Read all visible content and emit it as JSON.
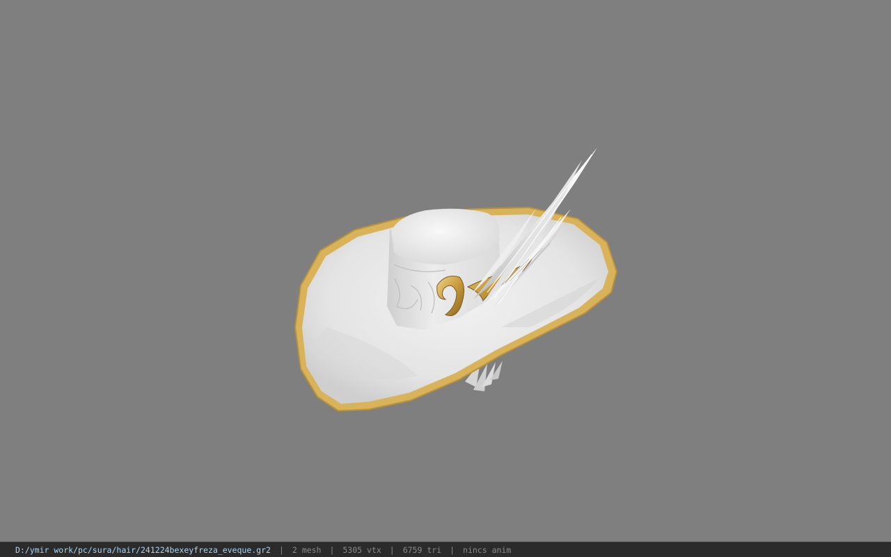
{
  "viewport": {
    "model_name": "hat-model",
    "background_color": "#7f7f7f",
    "brim_trim_color": "#d8b65a",
    "body_color": "#e9e9e9"
  },
  "status_bar": {
    "file_path": "D:/ymir work/pc/sura/hair/241224bexeyfreza_eveque.gr2",
    "separator": "|",
    "mesh_count": "2 mesh",
    "vertex_count": "5305 vtx",
    "triangle_count": "6759 tri",
    "anim_status": "nincs anim"
  }
}
